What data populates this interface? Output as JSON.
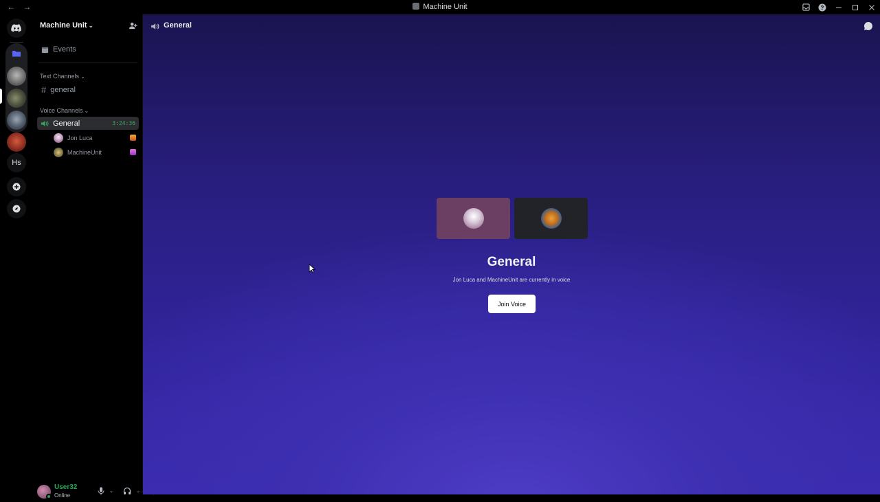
{
  "window": {
    "title": "Machine Unit",
    "nav_back": "←",
    "nav_forward": "→"
  },
  "server": {
    "name": "Machine Unit",
    "events_label": "Events",
    "text_category": "Text Channels",
    "voice_category": "Voice Channels",
    "text_channels": [
      "general"
    ],
    "voice_channel": {
      "name": "General",
      "timer": "3:24:36",
      "users": [
        "Jon Luca",
        "MachineUnit"
      ]
    }
  },
  "rail": {
    "hs_label": "Hs"
  },
  "user_panel": {
    "username": "User32",
    "status": "Online"
  },
  "main": {
    "channel_title": "General",
    "voice_heading": "General",
    "voice_subtitle": "Jon Luca and MachineUnit are currently in voice",
    "join_label": "Join Voice"
  },
  "colors": {
    "accent_green": "#23a55a",
    "timer_green": "#3ba55d",
    "tile_pink": "#6b3f63",
    "tile_dark": "#222328",
    "bg_purple": "#31249c"
  }
}
